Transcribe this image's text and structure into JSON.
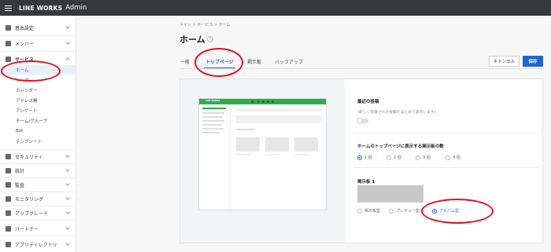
{
  "topbar": {
    "brand": "LINE WORKS",
    "product": "Admin"
  },
  "sidebar": {
    "items": [
      {
        "label": "基本設定",
        "icon": "building-icon"
      },
      {
        "label": "メンバー",
        "icon": "people-icon"
      },
      {
        "label": "サービス",
        "icon": "gear-icon"
      },
      {
        "label": "セキュリティ",
        "icon": "lock-icon"
      },
      {
        "label": "統計",
        "icon": "pie-chart-icon"
      },
      {
        "label": "監査",
        "icon": "clipboard-icon"
      },
      {
        "label": "モニタリング",
        "icon": "monitor-icon"
      },
      {
        "label": "アップグレード",
        "icon": "upgrade-icon"
      },
      {
        "label": "パートナー",
        "icon": "handshake-icon"
      },
      {
        "label": "アプリディレクトリ",
        "icon": "layers-icon"
      }
    ],
    "service_sub": [
      "ホーム",
      "トーク",
      "カレンダー",
      "アドレス帳",
      "アンケート",
      "チーム/グループ",
      "Bot",
      "テンプレート"
    ]
  },
  "breadcrumb": "メイン > サービス > ホーム",
  "page_title": "ホーム",
  "tabs": [
    "一般",
    "トップページ",
    "掲示板",
    "バックアップ"
  ],
  "buttons": {
    "cancel": "キャンセル",
    "save": "保存"
  },
  "mock_brand": "LINE WORKS",
  "settings": {
    "recent": {
      "title": "最近の投稿",
      "desc": "(新しく登録された投稿をまとめて表示します)"
    },
    "count": {
      "title": "ホームのトップページに表示する掲示板の数",
      "options": [
        "1 個",
        "2 個",
        "3 個",
        "4 個"
      ],
      "selected": "1 個"
    },
    "board": {
      "title": "掲示板 1",
      "options": [
        "掲示板型",
        "プレビュー型",
        "アルバム型"
      ],
      "selected": "アルバム型"
    }
  },
  "colors": {
    "accent": "#1e64d8",
    "annotation": "#e0131f",
    "topbar": "#35383f",
    "brand_green": "#27b14a"
  }
}
